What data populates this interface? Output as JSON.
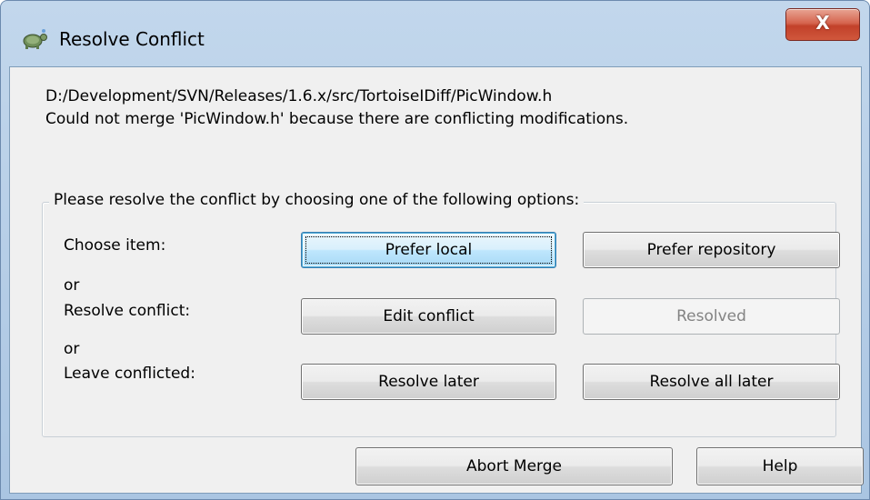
{
  "window": {
    "title": "Resolve Conflict",
    "app_icon": "tortoise-icon",
    "close_label": "X",
    "close_icon": "close-icon"
  },
  "message": {
    "path": "D:/Development/SVN/Releases/1.6.x/src/TortoiseIDiff/PicWindow.h",
    "description": "Could not merge 'PicWindow.h' because there are conflicting modifications."
  },
  "options_group": {
    "legend": "Please resolve the conflict by choosing one of the following options:",
    "rows": [
      {
        "label": "Choose item:"
      },
      {
        "separator": "or"
      },
      {
        "label": "Resolve conflict:"
      },
      {
        "separator": "or"
      },
      {
        "label": "Leave conflicted:"
      }
    ],
    "buttons": {
      "prefer_local": "Prefer local",
      "prefer_repository": "Prefer repository",
      "edit_conflict": "Edit conflict",
      "resolved": "Resolved",
      "resolve_later": "Resolve later",
      "resolve_all_later": "Resolve all later"
    }
  },
  "footer": {
    "abort_merge": "Abort Merge",
    "help": "Help"
  },
  "colors": {
    "frame": "#b9d0e8",
    "client": "#f0f0f0",
    "close_button": "#c2412a",
    "default_button": "#bee6fd"
  }
}
